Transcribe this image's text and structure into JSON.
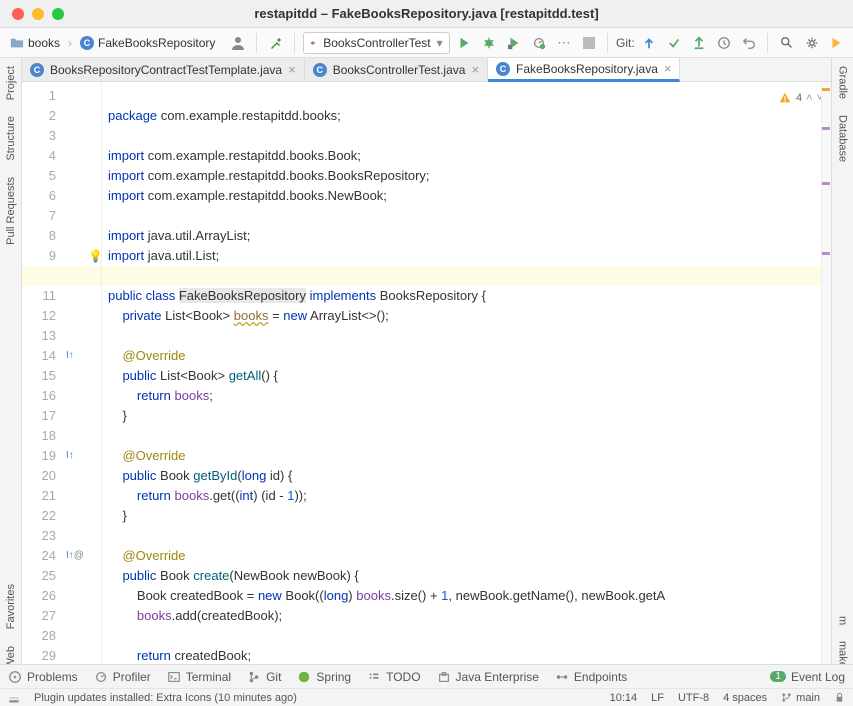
{
  "title": "restapitdd – FakeBooksRepository.java [restapitdd.test]",
  "breadcrumbs": {
    "a": "books",
    "b": "FakeBooksRepository"
  },
  "runconfig": "BooksControllerTest",
  "git_label": "Git:",
  "left_tabs": {
    "project": "Project",
    "structure": "Structure",
    "pull": "Pull Requests",
    "fav": "Favorites",
    "web": "Web"
  },
  "right_tabs": {
    "gradle": "Gradle",
    "db": "Database",
    "m": "m",
    "make": "make"
  },
  "tabs": [
    {
      "label": "BooksRepositoryContractTestTemplate.java"
    },
    {
      "label": "BooksControllerTest.java"
    },
    {
      "label": "FakeBooksRepository.java"
    }
  ],
  "inspection_count": "4",
  "code": {
    "l1a": "package",
    "l1b": " com.example.restapitdd.books;",
    "l3a": "import",
    "l3b": " com.example.restapitdd.books.Book;",
    "l4a": "import",
    "l4b": " com.example.restapitdd.books.BooksRepository;",
    "l5a": "import",
    "l5b": " com.example.restapitdd.books.NewBook;",
    "l7a": "import",
    "l7b": " java.util.ArrayList;",
    "l8a": "import",
    "l8b": " java.util.List;",
    "l10a": "public class ",
    "l10b": "FakeBooksRepository",
    "l10c": " ",
    "l10d": "implements",
    "l10e": " BooksRepository {",
    "l11a": "    ",
    "l11b": "private",
    "l11c": " List<Book> ",
    "l11d": "books",
    "l11e": " = ",
    "l11f": "new",
    "l11g": " ArrayList<>();",
    "l13": "    @Override",
    "l14a": "    ",
    "l14b": "public",
    "l14c": " List<Book> ",
    "l14d": "getAll",
    "l14e": "() {",
    "l15a": "        ",
    "l15b": "return",
    "l15c": " ",
    "l15d": "books",
    "l15e": ";",
    "l16": "    }",
    "l18": "    @Override",
    "l19a": "    ",
    "l19b": "public",
    "l19c": " Book ",
    "l19d": "getById",
    "l19e": "(",
    "l19f": "long",
    "l19g": " id) {",
    "l20a": "        ",
    "l20b": "return",
    "l20c": " ",
    "l20d": "books",
    "l20e": ".get((",
    "l20f": "int",
    "l20g": ") (id - ",
    "l20h": "1",
    "l20i": "));",
    "l21": "    }",
    "l23": "    @Override",
    "l24a": "    ",
    "l24b": "public",
    "l24c": " Book ",
    "l24d": "create",
    "l24e": "(NewBook newBook) {",
    "l25a": "        Book createdBook = ",
    "l25b": "new",
    "l25c": " Book((",
    "l25d": "long",
    "l25e": ") ",
    "l25f": "books",
    "l25g": ".size() + ",
    "l25h": "1",
    "l25i": ", newBook.getName(), newBook.getA",
    "l26a": "        ",
    "l26b": "books",
    "l26c": ".add(createdBook);",
    "l28a": "        ",
    "l28b": "return",
    "l28c": " createdBook;",
    "l29": "    }"
  },
  "bottom": {
    "problems": "Problems",
    "profiler": "Profiler",
    "terminal": "Terminal",
    "git": "Git",
    "spring": "Spring",
    "todo": "TODO",
    "je": "Java Enterprise",
    "endpoints": "Endpoints",
    "eventlog": "Event Log",
    "event_count": "1"
  },
  "status": {
    "msg": "Plugin updates installed: Extra Icons (10 minutes ago)",
    "pos": "10:14",
    "le": "LF",
    "enc": "UTF-8",
    "indent": "4 spaces",
    "branch": "main"
  }
}
